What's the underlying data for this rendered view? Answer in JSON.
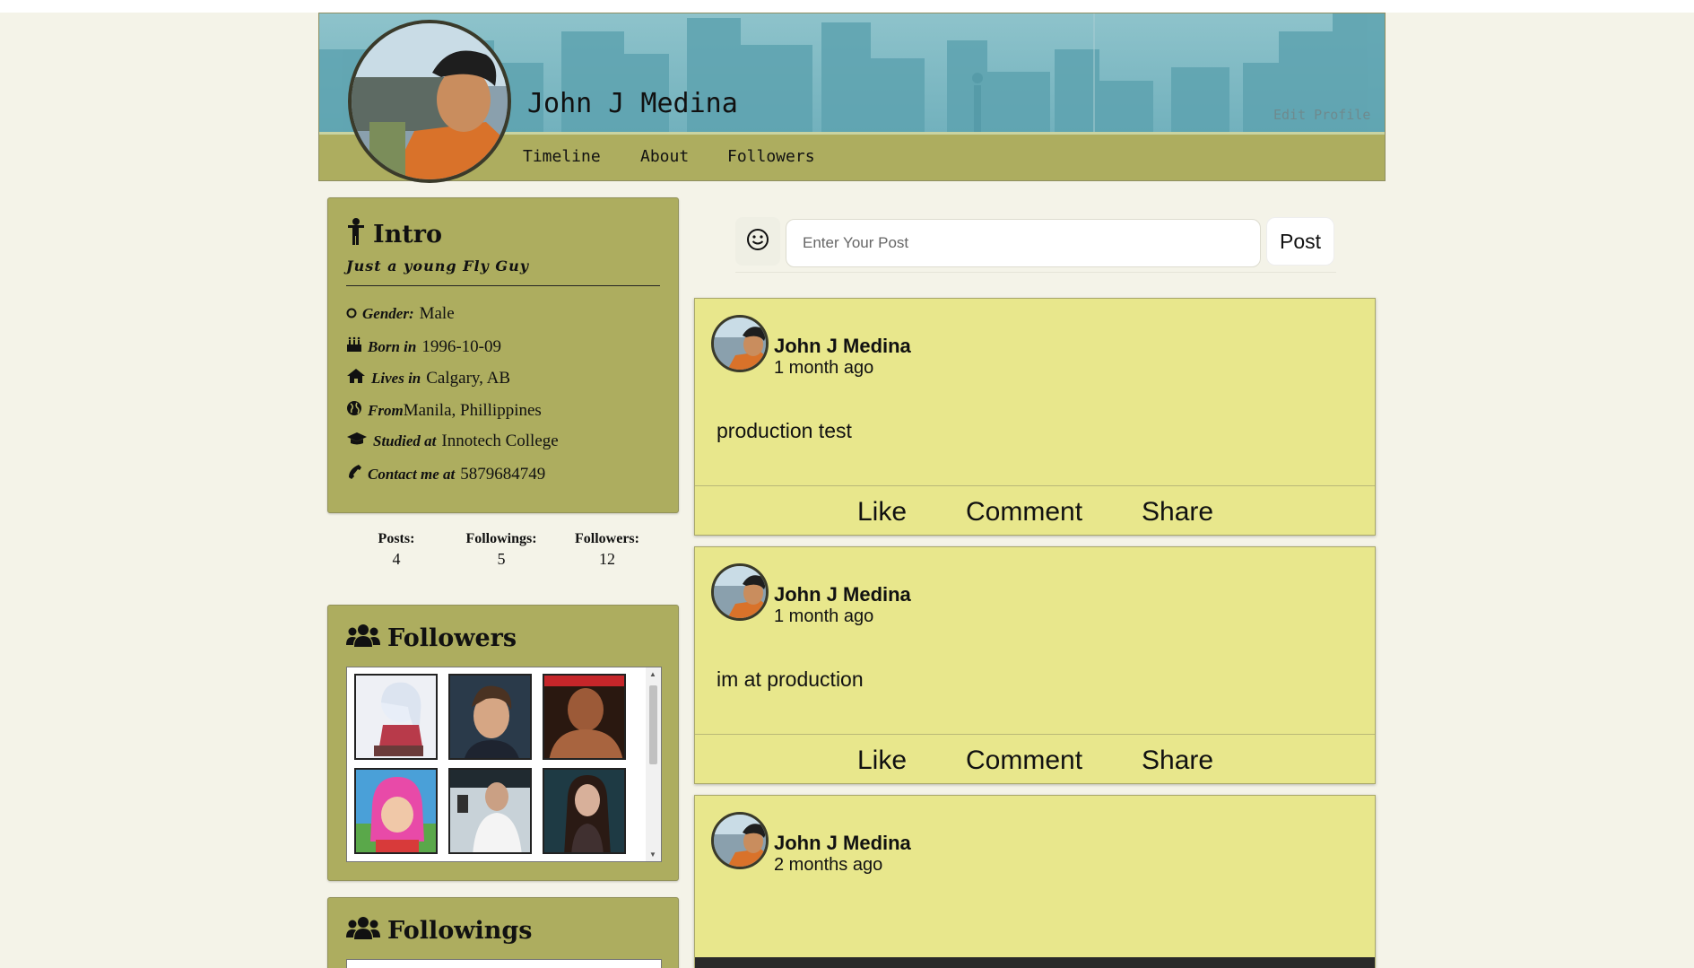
{
  "profile": {
    "name": "John J Medina",
    "edit_label": "Edit Profile",
    "avatar_icon": "profile-photo"
  },
  "nav": {
    "items": [
      {
        "label": "Timeline"
      },
      {
        "label": "About"
      },
      {
        "label": "Followers"
      }
    ]
  },
  "intro": {
    "title": "Intro",
    "tagline": "Just a young Fly Guy",
    "rows": [
      {
        "icon": "circle-icon",
        "label": "Gender:",
        "value": "Male"
      },
      {
        "icon": "birthday-cake-icon",
        "label": "Born in",
        "value": "1996-10-09"
      },
      {
        "icon": "home-icon",
        "label": "Lives in",
        "value": "Calgary, AB"
      },
      {
        "icon": "globe-icon",
        "label": "From",
        "value": "Manila, Phillippines"
      },
      {
        "icon": "graduation-cap-icon",
        "label": "Studied at",
        "value": "Innotech College"
      },
      {
        "icon": "phone-icon",
        "label": "Contact me at",
        "value": "5879684749"
      }
    ]
  },
  "stats": [
    {
      "label": "Posts:",
      "value": "4"
    },
    {
      "label": "Followings:",
      "value": "5"
    },
    {
      "label": "Followers:",
      "value": "12"
    }
  ],
  "followers": {
    "title": "Followers",
    "thumbs": [
      "anime-girl",
      "young-man",
      "wrestler",
      "pink-hair-girl",
      "man-white-shirt",
      "woman-dark"
    ]
  },
  "followings": {
    "title": "Followings"
  },
  "composer": {
    "placeholder": "Enter Your Post",
    "post_label": "Post"
  },
  "posts": [
    {
      "author": "John J Medina",
      "time": "1 month ago",
      "text": "production test"
    },
    {
      "author": "John J Medina",
      "time": "1 month ago",
      "text": "im at production"
    },
    {
      "author": "John J Medina",
      "time": "2 months ago",
      "text": ""
    }
  ],
  "actions": {
    "like": "Like",
    "comment": "Comment",
    "share": "Share"
  },
  "colors": {
    "page_bg": "#f4f3e8",
    "card_olive": "#adad5f",
    "post_yellow": "#e8e78c",
    "cover_teal": "#7db8c2"
  }
}
